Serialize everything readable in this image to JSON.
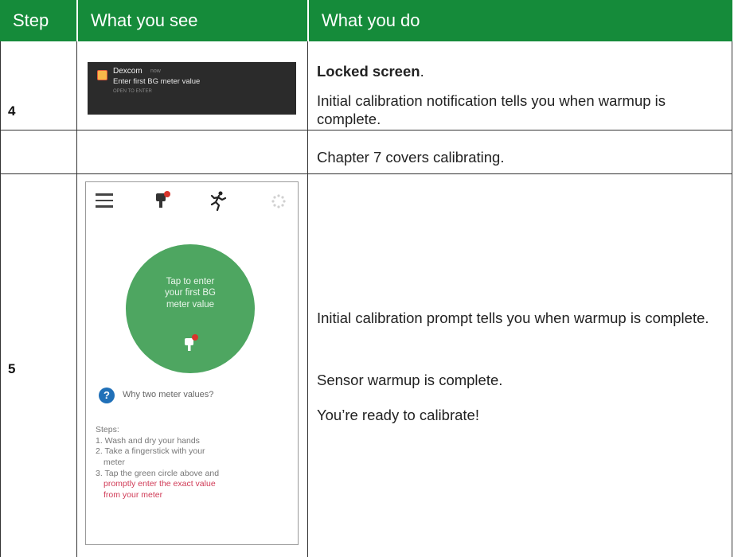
{
  "header": {
    "col1": "Step",
    "col2": "What you see",
    "col3": "What you do"
  },
  "rows": [
    {
      "step": "4",
      "notification": {
        "app_name": "Dexcom",
        "time_ago": "now",
        "message": "Enter first BG meter value",
        "tap_hint": "OPEN TO ENTER"
      },
      "do_title": "Locked screen",
      "do_title_suffix": ".",
      "do_lines": [
        "Initial calibration notification tells you when warmup is complete.",
        "Chapter 7 covers calibrating."
      ]
    },
    {
      "step": "5",
      "phone": {
        "circle_text_1": "Tap to enter",
        "circle_text_2": "your first BG",
        "circle_text_3": "meter value",
        "help_label": "Why two meter values?",
        "steps_title": "Steps:",
        "steps": [
          "1. Wash and dry your hands",
          "2. Take a fingerstick with your",
          "meter",
          "3. Tap the green circle above and"
        ],
        "steps_red_1": "promptly enter the exact value",
        "steps_red_2": "from your meter"
      },
      "do_lines": [
        "Initial calibration prompt tells you when warmup is complete.",
        "Sensor warmup is complete.",
        "You’re ready to calibrate!"
      ]
    }
  ],
  "colors": {
    "header_green": "#158b3a",
    "circle_green": "#4ea661",
    "help_blue": "#2070b8",
    "step_red": "#d03a56"
  },
  "icons": [
    "menu-icon",
    "sensor-alert-icon",
    "runner-icon",
    "loading-dots-icon",
    "help-icon",
    "dexcom-app-icon"
  ]
}
